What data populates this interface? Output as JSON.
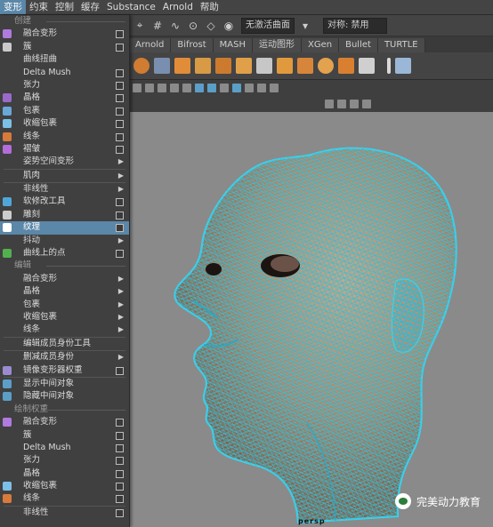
{
  "menubar": {
    "items": [
      "变形",
      "约束",
      "控制",
      "缓存",
      "Substance",
      "Arnold",
      "帮助"
    ]
  },
  "statusline": {
    "surface_select": "无激活曲面",
    "symmetry_label": "对称: 禁用"
  },
  "shelf_tabs": [
    "Arnold",
    "Bifrost",
    "MASH",
    "运动图形",
    "XGen",
    "Bullet",
    "TURTLE"
  ],
  "dropdown": {
    "rows": [
      {
        "type": "section",
        "label": "创建"
      },
      {
        "type": "item",
        "label": "融合变形",
        "trail": "box",
        "icon": "blend-icon",
        "icon_color": "#b07adf"
      },
      {
        "type": "item",
        "label": "簇",
        "trail": "box",
        "icon": "cluster-icon",
        "icon_color": "#c9c9c9"
      },
      {
        "type": "item",
        "label": "曲线扭曲",
        "trail": "none"
      },
      {
        "type": "item",
        "label": "Delta Mush",
        "trail": "box"
      },
      {
        "type": "item",
        "label": "张力",
        "trail": "box"
      },
      {
        "type": "item",
        "label": "晶格",
        "trail": "box",
        "icon": "lattice-icon",
        "icon_color": "#9a6acb"
      },
      {
        "type": "item",
        "label": "包裹",
        "trail": "box",
        "icon": "wrap-icon",
        "icon_color": "#6aa8d8"
      },
      {
        "type": "item",
        "label": "收缩包裹",
        "trail": "box",
        "icon": "shrink-wrap-icon",
        "icon_color": "#7cc0e8"
      },
      {
        "type": "item",
        "label": "线条",
        "trail": "box",
        "icon": "wire-icon",
        "icon_color": "#d77a3b"
      },
      {
        "type": "item",
        "label": "褶皱",
        "trail": "box",
        "icon": "wrinkle-icon",
        "icon_color": "#b26dd8"
      },
      {
        "type": "item",
        "label": "姿势空间变形",
        "trail": "arrow"
      },
      {
        "type": "sep"
      },
      {
        "type": "item",
        "label": "肌肉",
        "trail": "arrow"
      },
      {
        "type": "sep"
      },
      {
        "type": "item",
        "label": "非线性",
        "trail": "arrow"
      },
      {
        "type": "item",
        "label": "软修改工具",
        "trail": "box",
        "icon": "soft-mod-icon",
        "icon_color": "#4fa7d9"
      },
      {
        "type": "item",
        "label": "雕刻",
        "trail": "box",
        "icon": "sculpt-icon",
        "icon_color": "#cccccc"
      },
      {
        "type": "item",
        "label": "纹理",
        "trail": "box",
        "icon": "texture-icon",
        "icon_color": "#ffffff",
        "highlight": true
      },
      {
        "type": "item",
        "label": "抖动",
        "trail": "arrow"
      },
      {
        "type": "item",
        "label": "曲线上的点",
        "trail": "box",
        "icon": "point-on-curve-icon",
        "icon_color": "#53b04f"
      },
      {
        "type": "section",
        "label": "编辑"
      },
      {
        "type": "item",
        "label": "融合变形",
        "trail": "arrow"
      },
      {
        "type": "item",
        "label": "晶格",
        "trail": "arrow"
      },
      {
        "type": "item",
        "label": "包裹",
        "trail": "arrow"
      },
      {
        "type": "item",
        "label": "收缩包裹",
        "trail": "arrow"
      },
      {
        "type": "item",
        "label": "线条",
        "trail": "arrow"
      },
      {
        "type": "sep"
      },
      {
        "type": "item",
        "label": "编辑成员身份工具",
        "trail": "none"
      },
      {
        "type": "sep"
      },
      {
        "type": "item",
        "label": "删减成员身份",
        "trail": "arrow"
      },
      {
        "type": "item",
        "label": "镜像变形器权重",
        "trail": "box",
        "icon": "mirror-weights-icon",
        "icon_color": "#9a8ad0"
      },
      {
        "type": "sep"
      },
      {
        "type": "item",
        "label": "显示中间对象",
        "trail": "none",
        "icon": "show-intermediate-icon",
        "icon_color": "#5b9ec8"
      },
      {
        "type": "item",
        "label": "隐藏中间对象",
        "trail": "none",
        "icon": "hide-intermediate-icon",
        "icon_color": "#5b9ec8"
      },
      {
        "type": "section",
        "label": "绘制权重"
      },
      {
        "type": "item",
        "label": "融合变形",
        "trail": "box",
        "icon": "paint-blend-icon",
        "icon_color": "#b07adf"
      },
      {
        "type": "item",
        "label": "簇",
        "trail": "box"
      },
      {
        "type": "item",
        "label": "Delta Mush",
        "trail": "box"
      },
      {
        "type": "item",
        "label": "张力",
        "trail": "box"
      },
      {
        "type": "item",
        "label": "晶格",
        "trail": "box"
      },
      {
        "type": "item",
        "label": "收缩包裹",
        "trail": "box",
        "icon": "paint-shrink-icon",
        "icon_color": "#7cc0e8"
      },
      {
        "type": "item",
        "label": "线条",
        "trail": "box",
        "icon": "paint-wire-icon",
        "icon_color": "#d77a3b"
      },
      {
        "type": "sep"
      },
      {
        "type": "item",
        "label": "非线性",
        "trail": "box"
      }
    ]
  },
  "viewport": {
    "camera_label": "persp"
  },
  "watermark": {
    "text": "完美动力教育"
  }
}
